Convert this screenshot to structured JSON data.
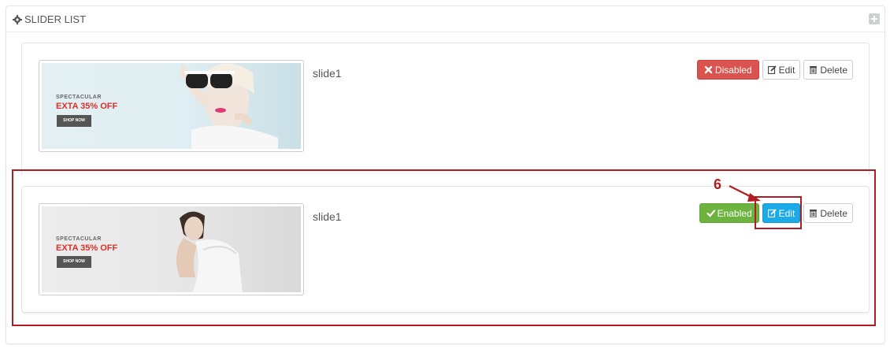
{
  "panel": {
    "title": "SLIDER LIST",
    "title_icon": "gear-icon",
    "add_icon": "plus-square-icon"
  },
  "slides": [
    {
      "name": "slide1",
      "promo_small": "SPECTACULAR",
      "promo_big": "EXTA 35% OFF",
      "shop_label": "SHOP NOW",
      "status_label": "Disabled",
      "status_icon": "x-icon",
      "status_color": "#d9534f",
      "edit_label": "Edit",
      "delete_label": "Delete"
    },
    {
      "name": "slide1",
      "promo_small": "SPECTACULAR",
      "promo_big": "EXTA 35% OFF",
      "shop_label": "SHOP NOW",
      "status_label": "Enabled",
      "status_icon": "check-icon",
      "status_color": "#6cb33f",
      "edit_label": "Edit",
      "delete_label": "Delete"
    }
  ],
  "annotation": {
    "step_number": "6",
    "highlight_color": "#b01e23"
  }
}
